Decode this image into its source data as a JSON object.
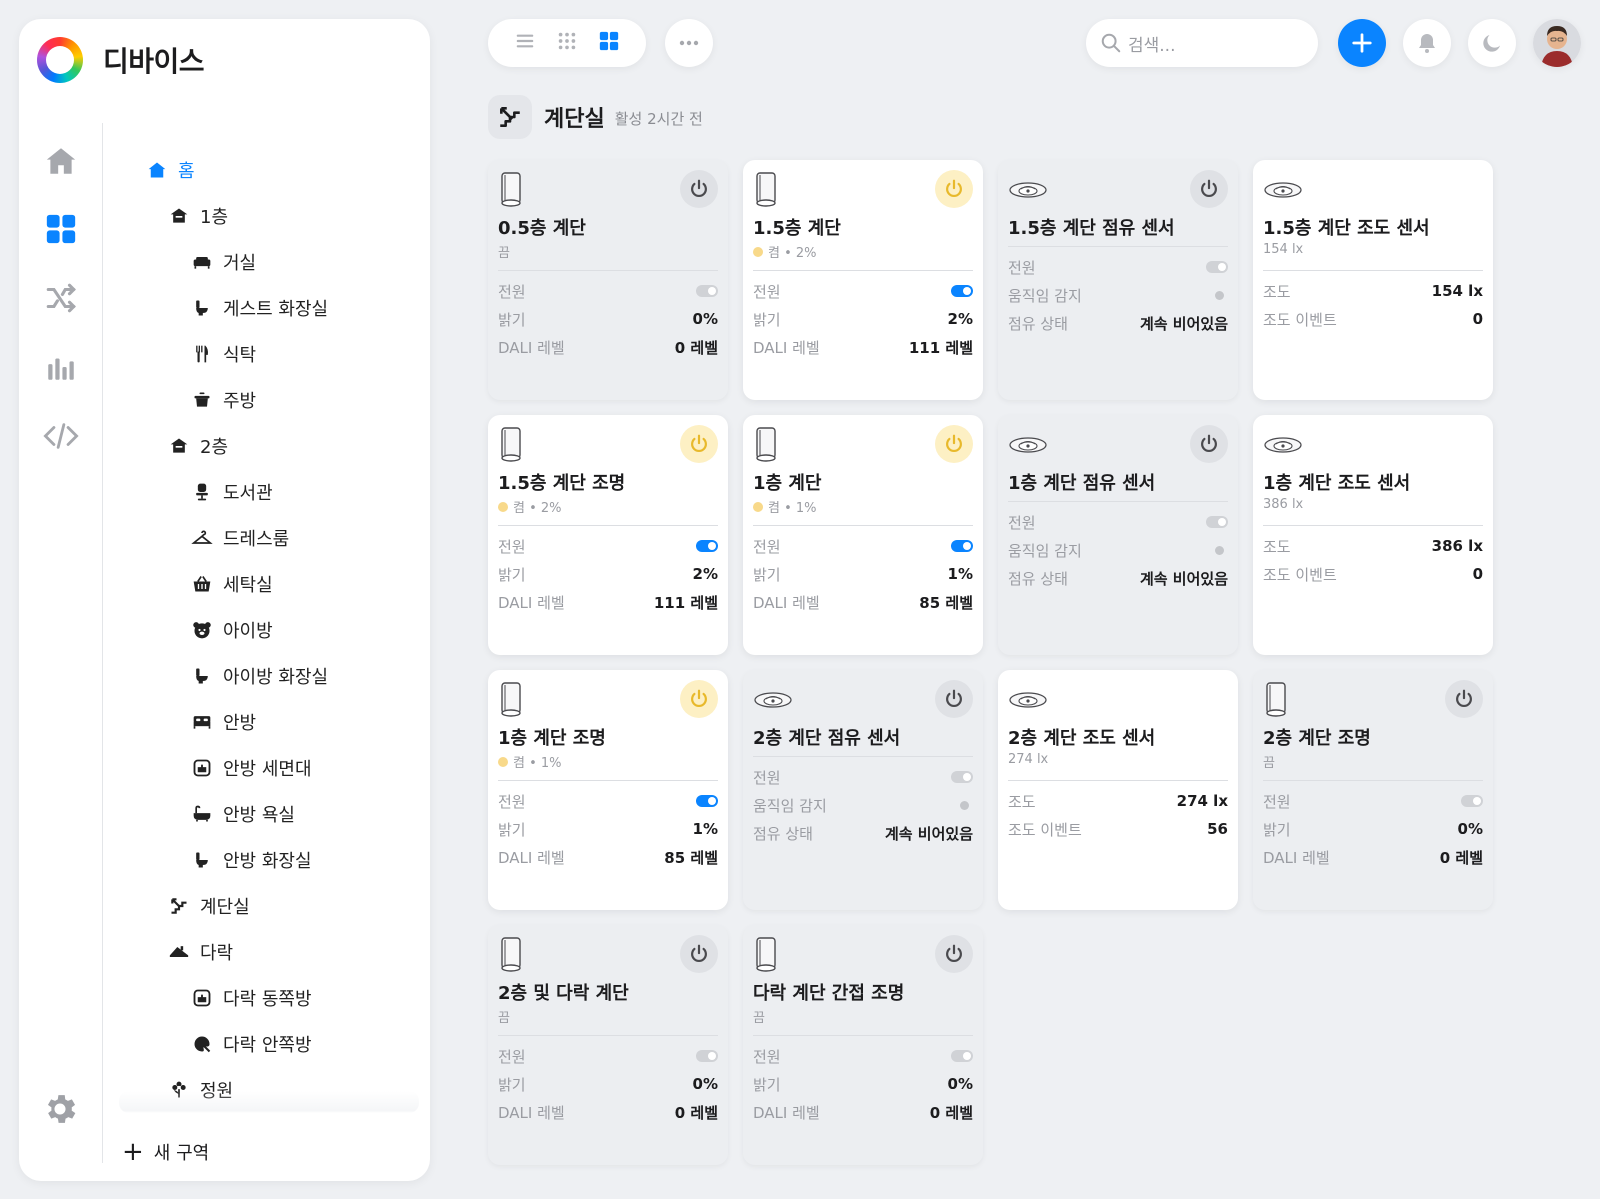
{
  "app": {
    "title": "디바이스"
  },
  "search": {
    "placeholder": "검색..."
  },
  "room": {
    "name": "계단실",
    "status": "활성 2시간 전"
  },
  "tree": {
    "home": "홈",
    "items": [
      {
        "label": "1층",
        "icon": "floor-icon",
        "level": 1
      },
      {
        "label": "거실",
        "icon": "sofa-icon",
        "level": 2
      },
      {
        "label": "게스트 화장실",
        "icon": "toilet-icon",
        "level": 2
      },
      {
        "label": "식탁",
        "icon": "utensils-icon",
        "level": 2
      },
      {
        "label": "주방",
        "icon": "pot-icon",
        "level": 2
      },
      {
        "label": "2층",
        "icon": "floor-icon",
        "level": 1
      },
      {
        "label": "도서관",
        "icon": "desk-chair-icon",
        "level": 2
      },
      {
        "label": "드레스룸",
        "icon": "hanger-icon",
        "level": 2
      },
      {
        "label": "세탁실",
        "icon": "basket-icon",
        "level": 2
      },
      {
        "label": "아이방",
        "icon": "bear-icon",
        "level": 2
      },
      {
        "label": "아이방 화장실",
        "icon": "toilet-icon",
        "level": 2
      },
      {
        "label": "안방",
        "icon": "bed-icon",
        "level": 2
      },
      {
        "label": "안방 세면대",
        "icon": "sink-icon",
        "level": 2
      },
      {
        "label": "안방 욕실",
        "icon": "bathtub-icon",
        "level": 2
      },
      {
        "label": "안방 화장실",
        "icon": "toilet-icon",
        "level": 2
      },
      {
        "label": "계단실",
        "icon": "stairs-icon",
        "level": 1
      },
      {
        "label": "다락",
        "icon": "attic-icon",
        "level": 1
      },
      {
        "label": "다락 동쪽방",
        "icon": "sink-icon",
        "level": 2
      },
      {
        "label": "다락 안쪽방",
        "icon": "paint-icon",
        "level": 2
      },
      {
        "label": "정원",
        "icon": "flower-icon",
        "level": 1
      }
    ],
    "new_zone": "새 구역"
  },
  "cards": [
    {
      "name": "0.5층 계단",
      "sub": "끔",
      "on": false,
      "lit": false,
      "type": "light",
      "rows": [
        {
          "k": "전원",
          "toggle": false
        },
        {
          "k": "밝기",
          "v": "0%"
        },
        {
          "k": "DALI 레벨",
          "v": "0 레벨"
        }
      ]
    },
    {
      "name": "1.5층 계단",
      "sub": "켬 • 2%",
      "on": true,
      "lit": true,
      "type": "light",
      "rows": [
        {
          "k": "전원",
          "toggle": true
        },
        {
          "k": "밝기",
          "v": "2%"
        },
        {
          "k": "DALI 레벨",
          "v": "111 레벨"
        }
      ]
    },
    {
      "name": "1.5층 계단 점유 센서",
      "sub": "",
      "on": false,
      "lit": false,
      "type": "sensor",
      "rows": [
        {
          "k": "전원",
          "toggle": false
        },
        {
          "k": "움직임 감지",
          "dot": true
        },
        {
          "k": "점유 상태",
          "v": "계속 비어있음"
        }
      ]
    },
    {
      "name": "1.5층 계단 조도 센서",
      "sub": "154 lx",
      "on": true,
      "lit": false,
      "type": "sensor",
      "nopower": true,
      "rows": [
        {
          "k": "조도",
          "v": "154 lx"
        },
        {
          "k": "조도 이벤트",
          "v": "0"
        }
      ]
    },
    {
      "name": "1.5층 계단 조명",
      "sub": "켬 • 2%",
      "on": true,
      "lit": true,
      "type": "light",
      "rows": [
        {
          "k": "전원",
          "toggle": true
        },
        {
          "k": "밝기",
          "v": "2%"
        },
        {
          "k": "DALI 레벨",
          "v": "111 레벨"
        }
      ]
    },
    {
      "name": "1층 계단",
      "sub": "켬 • 1%",
      "on": true,
      "lit": true,
      "type": "light",
      "rows": [
        {
          "k": "전원",
          "toggle": true
        },
        {
          "k": "밝기",
          "v": "1%"
        },
        {
          "k": "DALI 레벨",
          "v": "85 레벨"
        }
      ]
    },
    {
      "name": "1층 계단 점유 센서",
      "sub": "",
      "on": false,
      "lit": false,
      "type": "sensor",
      "rows": [
        {
          "k": "전원",
          "toggle": false
        },
        {
          "k": "움직임 감지",
          "dot": true
        },
        {
          "k": "점유 상태",
          "v": "계속 비어있음"
        }
      ]
    },
    {
      "name": "1층 계단 조도 센서",
      "sub": "386 lx",
      "on": true,
      "lit": false,
      "type": "sensor",
      "nopower": true,
      "rows": [
        {
          "k": "조도",
          "v": "386 lx"
        },
        {
          "k": "조도 이벤트",
          "v": "0"
        }
      ]
    },
    {
      "name": "1층 계단 조명",
      "sub": "켬 • 1%",
      "on": true,
      "lit": true,
      "type": "light",
      "rows": [
        {
          "k": "전원",
          "toggle": true
        },
        {
          "k": "밝기",
          "v": "1%"
        },
        {
          "k": "DALI 레벨",
          "v": "85 레벨"
        }
      ]
    },
    {
      "name": "2층 계단 점유 센서",
      "sub": "",
      "on": false,
      "lit": false,
      "type": "sensor",
      "rows": [
        {
          "k": "전원",
          "toggle": false
        },
        {
          "k": "움직임 감지",
          "dot": true
        },
        {
          "k": "점유 상태",
          "v": "계속 비어있음"
        }
      ]
    },
    {
      "name": "2층 계단 조도 센서",
      "sub": "274 lx",
      "on": true,
      "lit": false,
      "type": "sensor",
      "nopower": true,
      "rows": [
        {
          "k": "조도",
          "v": "274 lx"
        },
        {
          "k": "조도 이벤트",
          "v": "56"
        }
      ]
    },
    {
      "name": "2층 계단 조명",
      "sub": "끔",
      "on": false,
      "lit": false,
      "type": "light",
      "rows": [
        {
          "k": "전원",
          "toggle": false
        },
        {
          "k": "밝기",
          "v": "0%"
        },
        {
          "k": "DALI 레벨",
          "v": "0 레벨"
        }
      ]
    },
    {
      "name": "2층 및 다락 계단",
      "sub": "끔",
      "on": false,
      "lit": false,
      "type": "light",
      "rows": [
        {
          "k": "전원",
          "toggle": false
        },
        {
          "k": "밝기",
          "v": "0%"
        },
        {
          "k": "DALI 레벨",
          "v": "0 레벨"
        }
      ]
    },
    {
      "name": "다락 계단 간접 조명",
      "sub": "끔",
      "on": false,
      "lit": false,
      "type": "light",
      "rows": [
        {
          "k": "전원",
          "toggle": false
        },
        {
          "k": "밝기",
          "v": "0%"
        },
        {
          "k": "DALI 레벨",
          "v": "0 레벨"
        }
      ]
    }
  ],
  "colors": {
    "accent": "#0a84ff",
    "power_on": "#e8b92b",
    "background": "#eef0f3"
  }
}
